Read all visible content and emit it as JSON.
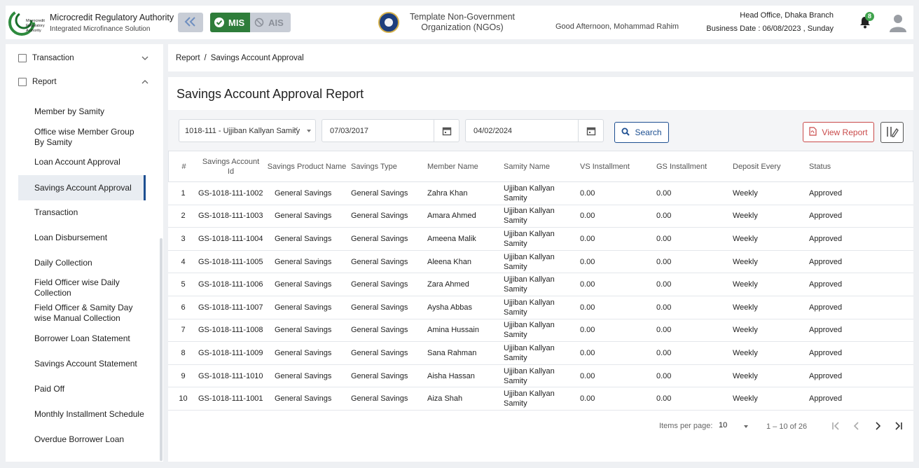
{
  "header": {
    "logo_text": "Microcredit Regulatory Authority",
    "title": "Microcredit Regulatory Authority",
    "subtitle": "Integrated Microfinance Solution",
    "mis_label": "MIS",
    "ais_label": "AIS",
    "org_name": "Template Non-Government Organization (NGOs)",
    "greeting": "Good Afternoon, Mohammad Rahim",
    "branch": "Head Office, Dhaka Branch",
    "business_date": "Business Date : 06/08/2023 , Sunday",
    "notification_count": "8"
  },
  "sidebar": {
    "top_items": [
      {
        "label": "Transaction",
        "icon": "report-icon",
        "chevron": "chevron-down-icon"
      },
      {
        "label": "Report",
        "icon": "report-icon",
        "chevron": "chevron-up-icon"
      }
    ],
    "items": [
      {
        "label": "Member by Samity"
      },
      {
        "label": "Office wise Member Group By Samity"
      },
      {
        "label": "Loan Account Approval"
      },
      {
        "label": "Savings Account Approval",
        "active": true
      },
      {
        "label": "Transaction"
      },
      {
        "label": "Loan Disbursement"
      },
      {
        "label": "Daily Collection"
      },
      {
        "label": "Field Officer wise Daily Collection"
      },
      {
        "label": "Field Officer & Samity Day wise Manual Collection"
      },
      {
        "label": "Borrower Loan Statement"
      },
      {
        "label": "Savings Account Statement"
      },
      {
        "label": "Paid Off"
      },
      {
        "label": "Monthly Installment Schedule"
      },
      {
        "label": "Overdue Borrower Loan"
      }
    ]
  },
  "breadcrumb": {
    "parent": "Report",
    "separator": "/",
    "current": "Savings Account Approval"
  },
  "page": {
    "title": "Savings Account Approval Report",
    "samity_select": "1018-111 - Ujjiban Kallyan Samity",
    "from_date": "07/03/2017",
    "to_date": "04/02/2024",
    "search_label": "Search",
    "view_report_label": "View Report"
  },
  "table": {
    "headers": [
      "#",
      "Savings Account Id",
      "Savings Product Name",
      "Savings Type",
      "Member Name",
      "Samity Name",
      "VS Installment",
      "GS Installment",
      "Deposit Every",
      "Status"
    ],
    "rows": [
      [
        "1",
        "GS-1018-111-1002",
        "General Savings",
        "General Savings",
        "Zahra Khan",
        "Ujjiban Kallyan Samity",
        "0.00",
        "0.00",
        "Weekly",
        "Approved"
      ],
      [
        "2",
        "GS-1018-111-1003",
        "General Savings",
        "General Savings",
        "Amara Ahmed",
        "Ujjiban Kallyan Samity",
        "0.00",
        "0.00",
        "Weekly",
        "Approved"
      ],
      [
        "3",
        "GS-1018-111-1004",
        "General Savings",
        "General Savings",
        "Ameena Malik",
        "Ujjiban Kallyan Samity",
        "0.00",
        "0.00",
        "Weekly",
        "Approved"
      ],
      [
        "4",
        "GS-1018-111-1005",
        "General Savings",
        "General Savings",
        "Aleena Khan",
        "Ujjiban Kallyan Samity",
        "0.00",
        "0.00",
        "Weekly",
        "Approved"
      ],
      [
        "5",
        "GS-1018-111-1006",
        "General Savings",
        "General Savings",
        "Zara Ahmed",
        "Ujjiban Kallyan Samity",
        "0.00",
        "0.00",
        "Weekly",
        "Approved"
      ],
      [
        "6",
        "GS-1018-111-1007",
        "General Savings",
        "General Savings",
        "Aysha Abbas",
        "Ujjiban Kallyan Samity",
        "0.00",
        "0.00",
        "Weekly",
        "Approved"
      ],
      [
        "7",
        "GS-1018-111-1008",
        "General Savings",
        "General Savings",
        "Amina Hussain",
        "Ujjiban Kallyan Samity",
        "0.00",
        "0.00",
        "Weekly",
        "Approved"
      ],
      [
        "8",
        "GS-1018-111-1009",
        "General Savings",
        "General Savings",
        "Sana Rahman",
        "Ujjiban Kallyan Samity",
        "0.00",
        "0.00",
        "Weekly",
        "Approved"
      ],
      [
        "9",
        "GS-1018-111-1010",
        "General Savings",
        "General Savings",
        "Aisha Hassan",
        "Ujjiban Kallyan Samity",
        "0.00",
        "0.00",
        "Weekly",
        "Approved"
      ],
      [
        "10",
        "GS-1018-111-1001",
        "General Savings",
        "General Savings",
        "Aiza Shah",
        "Ujjiban Kallyan Samity",
        "0.00",
        "0.00",
        "Weekly",
        "Approved"
      ]
    ]
  },
  "pagination": {
    "items_per_page_label": "Items per page:",
    "items_per_page": "10",
    "range": "1 – 10 of 26"
  },
  "colors": {
    "primary": "#1d4f91",
    "mis_green": "#2e7d3a",
    "danger": "#c94a4a",
    "badge_green": "#3fa34d"
  }
}
